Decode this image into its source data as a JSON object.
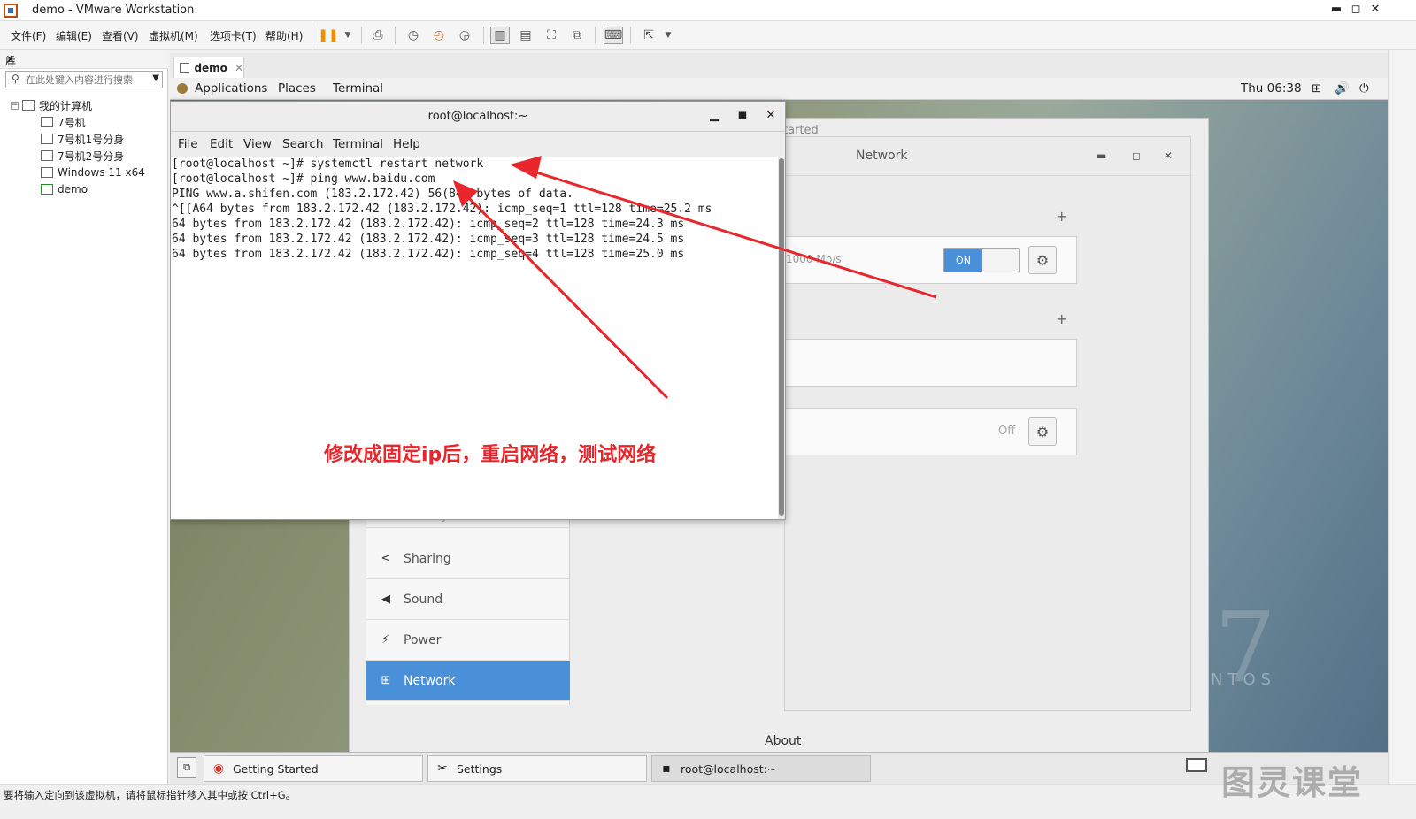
{
  "window": {
    "title": "demo - VMware Workstation",
    "minimize": "▬",
    "maximize": "◻",
    "close": "✕"
  },
  "menu": [
    "文件(F)",
    "编辑(E)",
    "查看(V)",
    "虚拟机(M)",
    "选项卡(T)",
    "帮助(H)"
  ],
  "library": {
    "title": "库",
    "close": "✕",
    "search_placeholder": "在此处键入内容进行搜索",
    "root": "我的计算机",
    "items": [
      "7号机",
      "7号机1号分身",
      "7号机2号分身",
      "Windows 11 x64",
      "demo"
    ]
  },
  "tab": {
    "label": "demo",
    "close": "✕"
  },
  "gnome_top": {
    "applications": "Applications",
    "places": "Places",
    "terminal": "Terminal",
    "clock": "Thu 06:38"
  },
  "terminal": {
    "title": "root@localhost:~",
    "menu": [
      "File",
      "Edit",
      "View",
      "Search",
      "Terminal",
      "Help"
    ],
    "lines": [
      "[root@localhost ~]# systemctl restart network",
      "[root@localhost ~]# ping www.baidu.com",
      "PING www.a.shifen.com (183.2.172.42) 56(84) bytes of data.",
      "^[[A64 bytes from 183.2.172.42 (183.2.172.42): icmp_seq=1 ttl=128 time=25.2 ms",
      "64 bytes from 183.2.172.42 (183.2.172.42): icmp_seq=2 ttl=128 time=24.3 ms",
      "64 bytes from 183.2.172.42 (183.2.172.42): icmp_seq=3 ttl=128 time=24.5 ms",
      "64 bytes from 183.2.172.42 (183.2.172.42): icmp_seq=4 ttl=128 time=25.0 ms"
    ]
  },
  "settings": {
    "behind_title": "tarted",
    "network_title": "Network",
    "speed": "1000 Mb/s",
    "toggle_on": "ON",
    "off_label": "Off",
    "sidebar": [
      "Privacy",
      "Sharing",
      "Sound",
      "Power",
      "Network"
    ],
    "about": "About"
  },
  "annotation": "修改成固定ip后，重启网络，测试网络",
  "taskbar": [
    "Getting Started",
    "Settings",
    "root@localhost:~"
  ],
  "centos": {
    "seven": "7",
    "text": "NTOS"
  },
  "statusbar": "要将输入定向到该虚拟机，请将鼠标指针移入其中或按 Ctrl+G。",
  "watermark": "图灵课堂"
}
